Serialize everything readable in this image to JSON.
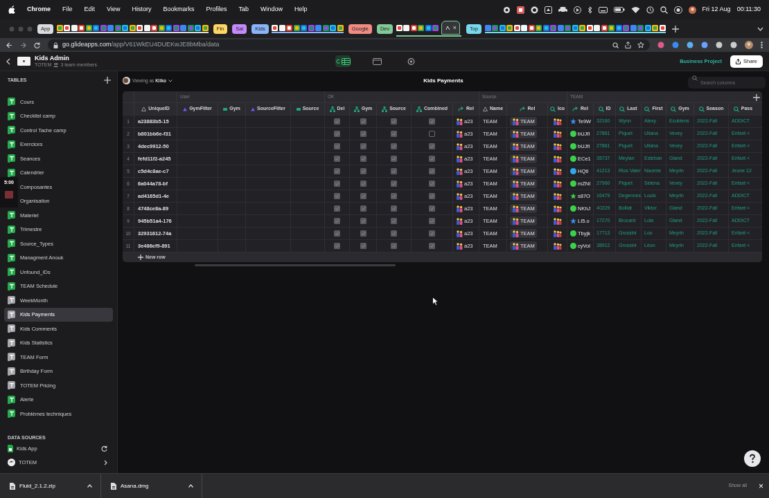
{
  "menu_bar": {
    "app": "Chrome",
    "items": [
      "File",
      "Edit",
      "View",
      "History",
      "Bookmarks",
      "Profiles",
      "Tab",
      "Window",
      "Help"
    ],
    "date": "Fri 12 Aug",
    "time": "00:11:30"
  },
  "tab_groups": [
    {
      "label": "App",
      "color": "#dadce0"
    },
    {
      "label": "Fin",
      "color": "#fdd663"
    },
    {
      "label": "Sal",
      "color": "#c58af9"
    },
    {
      "label": "Kids",
      "color": "#8ab4f8"
    },
    {
      "label": "Google",
      "color": "#f28b82"
    },
    {
      "label": "Dev",
      "color": "#81c995"
    },
    {
      "label": "Top",
      "color": "#78d9ec"
    }
  ],
  "active_tab": {
    "close": "×"
  },
  "address_bar": {
    "host": "go.glideapps.com",
    "path": "/app/V61WkEU4DUEKwJE8bMba/data"
  },
  "app_header": {
    "title": "Kids Admin",
    "team": "TOTEM",
    "members": "3 team members",
    "plan": "Business Project",
    "share": "Share"
  },
  "mode_tabs": [
    {
      "kind": "data",
      "selected": true
    },
    {
      "kind": "layout",
      "selected": false
    },
    {
      "kind": "settings",
      "selected": false
    }
  ],
  "sidebar": {
    "tables_label": "TABLES",
    "items": [
      {
        "label": "Cours",
        "kind": "sheet",
        "selected": false
      },
      {
        "label": "Checklist camp",
        "kind": "sheet",
        "selected": false
      },
      {
        "label": "Control Tache camp",
        "kind": "sheet",
        "selected": false
      },
      {
        "label": "Exercices",
        "kind": "sheet",
        "selected": false
      },
      {
        "label": "Seances",
        "kind": "sheet",
        "selected": false
      },
      {
        "label": "Calendrier",
        "kind": "sheet",
        "selected": false
      },
      {
        "label": "Composantes",
        "kind": "covered",
        "selected": false
      },
      {
        "label": "Organisation",
        "kind": "covered",
        "selected": false
      },
      {
        "label": "Materiel",
        "kind": "sheet",
        "selected": false
      },
      {
        "label": "Trimestre",
        "kind": "sheet",
        "selected": false
      },
      {
        "label": "Source_Types",
        "kind": "sheet",
        "selected": false
      },
      {
        "label": "Managment Anouk",
        "kind": "sheet",
        "selected": false
      },
      {
        "label": "Unfound_IDs",
        "kind": "sheet",
        "selected": false
      },
      {
        "label": "TEAM Schedule",
        "kind": "sheet",
        "selected": false
      },
      {
        "label": "WeekMonth",
        "kind": "glide",
        "selected": false
      },
      {
        "label": "Kids Payments",
        "kind": "glide",
        "selected": true
      },
      {
        "label": "Kids Comments",
        "kind": "glide",
        "selected": false
      },
      {
        "label": "Kids Statistics",
        "kind": "glide",
        "selected": false
      },
      {
        "label": "TEAM Form",
        "kind": "glide",
        "selected": false
      },
      {
        "label": "Birthday Form",
        "kind": "glide",
        "selected": false
      },
      {
        "label": "TOTEM Pricing",
        "kind": "glide",
        "selected": false
      },
      {
        "label": "Alerte",
        "kind": "sheet",
        "selected": false
      },
      {
        "label": "Problèmes techniques",
        "kind": "sheet",
        "selected": false
      }
    ],
    "sources_label": "DATA SOURCES",
    "sources": [
      {
        "label": "Kids App",
        "kind": "sheets"
      },
      {
        "label": "TOTEM",
        "kind": "glide"
      }
    ]
  },
  "overlay_timer": "5:00",
  "viewer": {
    "prefix": "Viewing as",
    "name": "Kiiko"
  },
  "table": {
    "title": "Kids Payments",
    "search_placeholder": "Search columns",
    "new_row": "New row",
    "groups": [
      {
        "columns": [
          {
            "label": "UniqueID",
            "kind": "text"
          }
        ]
      },
      {
        "label": "User",
        "columns": [
          {
            "label": "GymFilter",
            "kind": "filter"
          },
          {
            "label": "Gym",
            "kind": "choice"
          },
          {
            "label": "SourceFilter",
            "kind": "filter"
          },
          {
            "label": "Source",
            "kind": "choice"
          }
        ]
      },
      {
        "label": "OK",
        "columns": [
          {
            "label": "Del",
            "kind": "boolean"
          },
          {
            "label": "Gym",
            "kind": "boolean"
          },
          {
            "label": "Source",
            "kind": "boolean"
          },
          {
            "label": "Combined",
            "kind": "boolean"
          },
          {
            "label": "Rel",
            "kind": "relation"
          }
        ]
      },
      {
        "label": "Source",
        "columns": [
          {
            "label": "Name",
            "kind": "text"
          },
          {
            "label": "Rel",
            "kind": "relation"
          },
          {
            "label": "Ico",
            "kind": "image"
          }
        ]
      },
      {
        "label": "TEAM",
        "columns": [
          {
            "label": "Rel",
            "kind": "relation"
          },
          {
            "label": "ID",
            "kind": "lookup"
          },
          {
            "label": "Last",
            "kind": "lookup"
          },
          {
            "label": "First",
            "kind": "lookup"
          },
          {
            "label": "Gym",
            "kind": "lookup"
          },
          {
            "label": "Season",
            "kind": "lookup"
          },
          {
            "label": "Pass",
            "kind": "lookup"
          }
        ]
      }
    ],
    "rows": [
      {
        "number": "1",
        "texts": [
          "a23883b5-15",
          "TEAM"
        ],
        "checks": [
          true,
          true,
          true,
          true
        ],
        "rels": [
          {
            "kind": "chip",
            "text": "a23"
          },
          {
            "kind": "tag",
            "text": "TEAM"
          },
          {
            "kind": "star",
            "color": "#3b8ff5",
            "text": "Te9W"
          }
        ],
        "lookups": [
          "32160",
          "Wynn",
          "Alexy",
          "Ecublens",
          "2022-Fall",
          "ADDICT"
        ]
      },
      {
        "number": "2",
        "texts": [
          "b801bb6e-f31",
          "TEAM"
        ],
        "checks": [
          true,
          true,
          true,
          false
        ],
        "rels": [
          {
            "kind": "chip",
            "text": "a23"
          },
          {
            "kind": "tag",
            "text": "TEAM"
          },
          {
            "kind": "dot",
            "color": "#3bd14a",
            "text": "bUJfl"
          }
        ],
        "lookups": [
          "27861",
          "Piquet",
          "Uliana",
          "Vevey",
          "2022-Fall",
          "Enfant <"
        ]
      },
      {
        "number": "3",
        "texts": [
          "4dec9912-50",
          "TEAM"
        ],
        "checks": [
          true,
          true,
          true,
          true
        ],
        "rels": [
          {
            "kind": "chip",
            "text": "a23"
          },
          {
            "kind": "tag",
            "text": "TEAM"
          },
          {
            "kind": "dot",
            "color": "#3bd14a",
            "text": "bUJfl"
          }
        ],
        "lookups": [
          "27861",
          "Piquet",
          "Uliana",
          "Vevey",
          "2022-Fall",
          "Enfant <"
        ]
      },
      {
        "number": "4",
        "texts": [
          "fefd11f2-a245",
          "TEAM"
        ],
        "checks": [
          true,
          true,
          true,
          true
        ],
        "rels": [
          {
            "kind": "chip",
            "text": "a23"
          },
          {
            "kind": "tag",
            "text": "TEAM"
          },
          {
            "kind": "dot",
            "color": "#3bd14a",
            "text": "ECe1"
          }
        ],
        "lookups": [
          "35737",
          "Meylan",
          "Esteban",
          "Gland",
          "2022-Fall",
          "Enfant <"
        ]
      },
      {
        "number": "5",
        "texts": [
          "c5d4c8ae-c7",
          "TEAM"
        ],
        "checks": [
          true,
          true,
          true,
          true
        ],
        "rels": [
          {
            "kind": "chip",
            "text": "a23"
          },
          {
            "kind": "tag",
            "text": "TEAM"
          },
          {
            "kind": "dot",
            "color": "#2fa8f0",
            "text": "HQtI"
          }
        ],
        "lookups": [
          "41213",
          "Rios Valer",
          "Naomie",
          "Meyrin",
          "2022-Fall",
          "Jeune 12"
        ]
      },
      {
        "number": "6",
        "texts": [
          "6a044a78-bf",
          "TEAM"
        ],
        "checks": [
          true,
          true,
          true,
          true
        ],
        "rels": [
          {
            "kind": "chip",
            "text": "a23"
          },
          {
            "kind": "tag",
            "text": "TEAM"
          },
          {
            "kind": "dot",
            "color": "#3bd14a",
            "text": "mZNI"
          }
        ],
        "lookups": [
          "27960",
          "Piquet",
          "Selena",
          "Vevey",
          "2022-Fall",
          "Enfant <"
        ]
      },
      {
        "number": "7",
        "texts": [
          "ad4165d1-4e",
          "TEAM"
        ],
        "checks": [
          true,
          true,
          true,
          true
        ],
        "rels": [
          {
            "kind": "chip",
            "text": "a23"
          },
          {
            "kind": "tag",
            "text": "TEAM"
          },
          {
            "kind": "star",
            "color": "#3bd14a",
            "text": "s87O"
          }
        ],
        "lookups": [
          "16479",
          "Degennes",
          "Louis",
          "Meyrin",
          "2022-Fall",
          "ADDICT"
        ]
      },
      {
        "number": "8",
        "texts": [
          "4748ce8a-89",
          "TEAM"
        ],
        "checks": [
          true,
          true,
          true,
          true
        ],
        "rels": [
          {
            "kind": "chip",
            "text": "a23"
          },
          {
            "kind": "tag",
            "text": "TEAM"
          },
          {
            "kind": "dot",
            "color": "#3bd14a",
            "text": "NKhJ"
          }
        ],
        "lookups": [
          "40229",
          "Bolliat",
          "Viktor",
          "Gland",
          "2022-Fall",
          "Enfant <"
        ]
      },
      {
        "number": "9",
        "texts": [
          "945b51a4-176",
          "TEAM"
        ],
        "checks": [
          true,
          true,
          true,
          true
        ],
        "rels": [
          {
            "kind": "chip",
            "text": "a23"
          },
          {
            "kind": "tag",
            "text": "TEAM"
          },
          {
            "kind": "star",
            "color": "#3b8ff5",
            "text": "LI5.o"
          }
        ],
        "lookups": [
          "17270",
          "Brocard",
          "Lola",
          "Gland",
          "2022-Fall",
          "ADDICT"
        ]
      },
      {
        "number": "10",
        "texts": [
          "32931612-74a",
          "TEAM"
        ],
        "checks": [
          true,
          true,
          true,
          true
        ],
        "rels": [
          {
            "kind": "chip",
            "text": "a23"
          },
          {
            "kind": "tag",
            "text": "TEAM"
          },
          {
            "kind": "dot",
            "color": "#3bd14a",
            "text": "Tbyjk"
          }
        ],
        "lookups": [
          "17713",
          "Grossini",
          "Lou",
          "Meyrin",
          "2022-Fall",
          "Enfant <"
        ]
      },
      {
        "number": "11",
        "texts": [
          "3e486cf9-891",
          "TEAM"
        ],
        "checks": [
          true,
          true,
          true,
          true
        ],
        "rels": [
          {
            "kind": "chip",
            "text": "a23"
          },
          {
            "kind": "tag",
            "text": "TEAM"
          },
          {
            "kind": "dot",
            "color": "#3bd14a",
            "text": "cyVol"
          }
        ],
        "lookups": [
          "38912",
          "Grossini",
          "Léon",
          "Meyrin",
          "2022-Fall",
          "Enfant <"
        ]
      }
    ]
  },
  "downloads": {
    "files": [
      "Fluid_2.1.2.zip",
      "Asana.dmg"
    ],
    "show_all": "Show all",
    "close": "×"
  }
}
